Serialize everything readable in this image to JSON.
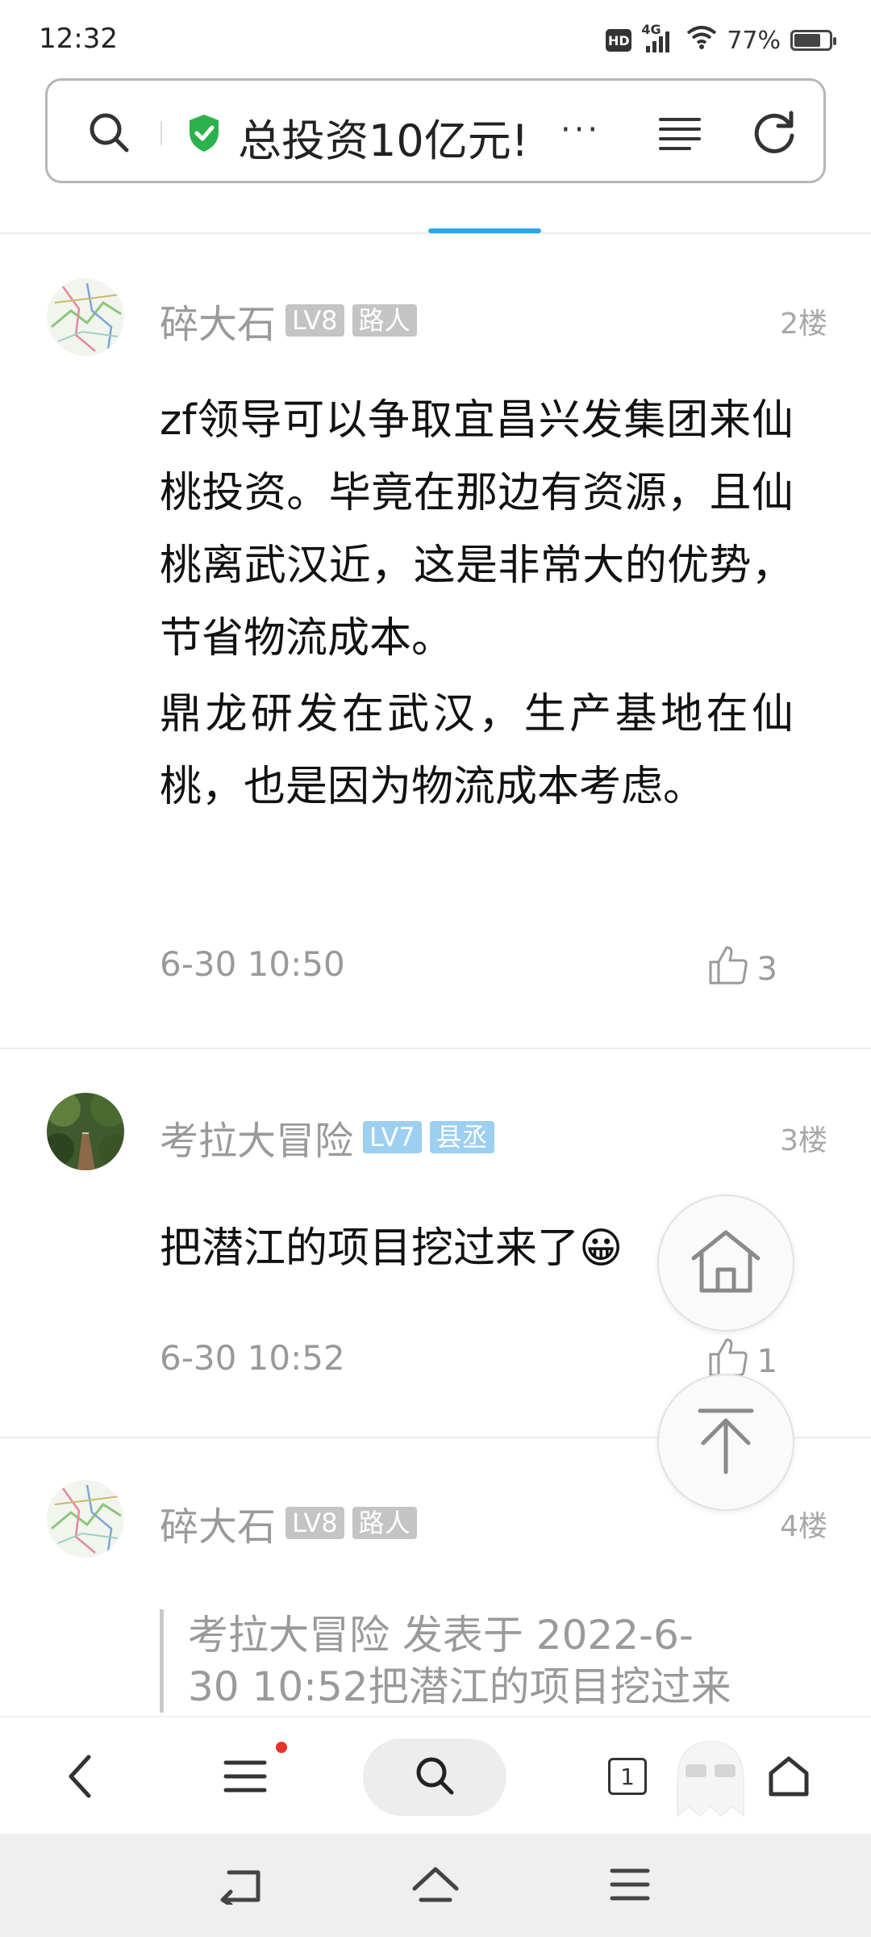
{
  "status_bar": {
    "time": "12:32",
    "hd_label": "HD",
    "network": "4G",
    "battery_text": "77%",
    "battery_level": 0.77,
    "icons": [
      "hd-icon",
      "signal-icon",
      "wifi-icon",
      "battery-icon"
    ]
  },
  "address_bar": {
    "title": "总投资10亿元!",
    "more": "···",
    "icons": [
      "search-icon",
      "shield-check-icon",
      "menu-icon",
      "refresh-icon"
    ]
  },
  "posts": [
    {
      "author": "碎大石",
      "level": "LV8",
      "role": "路人",
      "floor": "2楼",
      "paragraphs": [
        "zf领导可以争取宜昌兴发集团来仙桃投资。毕竟在那边有资源，且仙桃离武汉近，这是非常大的优势，节省物流成本。",
        "鼎龙研发在武汉，生产基地在仙桃，也是因为物流成本考虑。"
      ],
      "time": "6-30 10:50",
      "likes": "3"
    },
    {
      "author": "考拉大冒险",
      "level": "LV7",
      "role": "县丞",
      "floor": "3楼",
      "text": "把潜江的项目挖过来了",
      "emoji": "😀",
      "time": "6-30 10:52",
      "likes": "1"
    },
    {
      "author": "碎大石",
      "level": "LV8",
      "role": "路人",
      "floor": "4楼",
      "quote_line1": "考拉大冒险 发表于 2022-6-",
      "quote_line2": "30 10:52把潜江的项目挖过来"
    }
  ],
  "floating_buttons": [
    "home-icon",
    "back-to-top-icon"
  ],
  "toolbar": {
    "tab_count": "1",
    "icons": [
      "back-icon",
      "menu-icon",
      "search-icon",
      "tabs-icon",
      "home-icon"
    ]
  },
  "system_nav": [
    "back-icon",
    "home-icon",
    "recents-icon"
  ],
  "colors": {
    "accent": "#2ea6e8",
    "shield": "#2bb24c",
    "badge_gray": "#c4c4c4",
    "badge_blue": "#9ccff0",
    "notification_dot": "#e8322c"
  }
}
